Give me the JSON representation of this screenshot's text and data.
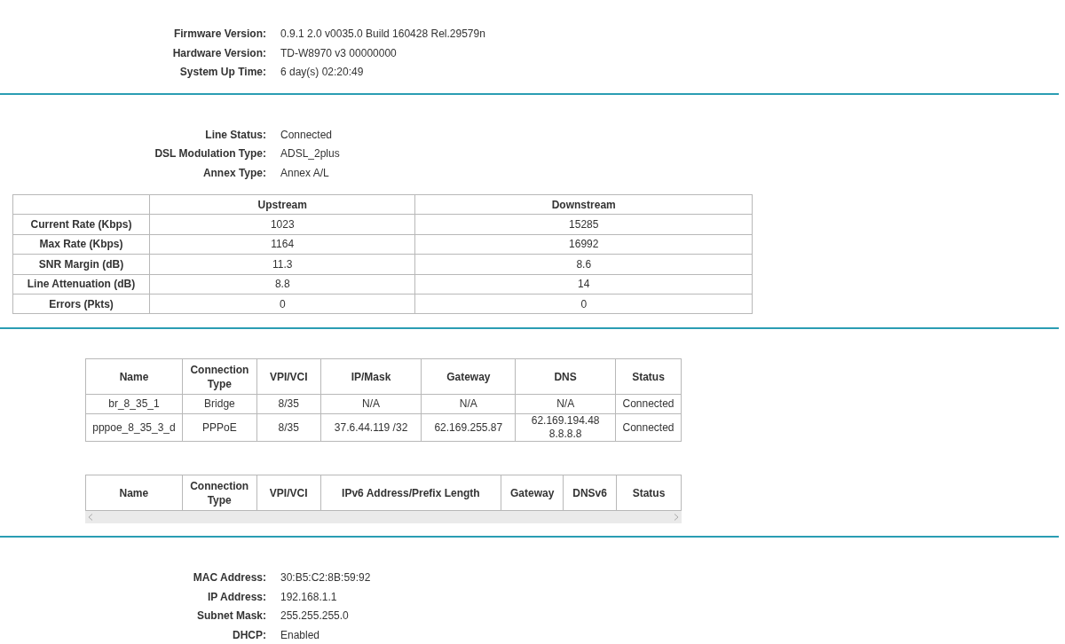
{
  "system": {
    "rows": [
      {
        "label": "Firmware Version:",
        "value": "0.9.1 2.0 v0035.0 Build 160428 Rel.29579n"
      },
      {
        "label": "Hardware Version:",
        "value": "TD-W8970 v3 00000000"
      },
      {
        "label": "System Up Time:",
        "value": "6 day(s) 02:20:49"
      }
    ]
  },
  "dsl": {
    "rows": [
      {
        "label": "Line Status:",
        "value": "Connected"
      },
      {
        "label": "DSL Modulation Type:",
        "value": "ADSL_2plus"
      },
      {
        "label": "Annex Type:",
        "value": "Annex A/L"
      }
    ],
    "table": {
      "columns": [
        "Upstream",
        "Downstream"
      ],
      "rows": [
        {
          "label": "Current Rate (Kbps)",
          "cells": [
            "1023",
            "15285"
          ]
        },
        {
          "label": "Max Rate (Kbps)",
          "cells": [
            "1164",
            "16992"
          ]
        },
        {
          "label": "SNR Margin (dB)",
          "cells": [
            "11.3",
            "8.6"
          ]
        },
        {
          "label": "Line Attenuation (dB)",
          "cells": [
            "8.8",
            "14"
          ]
        },
        {
          "label": "Errors (Pkts)",
          "cells": [
            "0",
            "0"
          ]
        }
      ]
    }
  },
  "wan": {
    "ipv4_table": {
      "columns": [
        "Name",
        "Connection Type",
        "VPI/VCI",
        "IP/Mask",
        "Gateway",
        "DNS",
        "Status"
      ],
      "rows": [
        [
          "br_8_35_1",
          "Bridge",
          "8/35",
          "N/A",
          "N/A",
          "N/A",
          "Connected"
        ],
        [
          "pppoe_8_35_3_d",
          "PPPoE",
          "8/35",
          "37.6.44.119 /32",
          "62.169.255.87",
          "62.169.194.48\n8.8.8.8",
          "Connected"
        ]
      ]
    },
    "ipv6_table": {
      "columns": [
        "Name",
        "Connection Type",
        "VPI/VCI",
        "IPv6 Address/Prefix Length",
        "Gateway",
        "DNSv6",
        "Status"
      ]
    }
  },
  "lan": {
    "rows": [
      {
        "label": "MAC Address:",
        "value": "30:B5:C2:8B:59:92"
      },
      {
        "label": "IP Address:",
        "value": "192.168.1.1"
      },
      {
        "label": "Subnet Mask:",
        "value": "255.255.255.0"
      },
      {
        "label": "DHCP:",
        "value": "Enabled"
      }
    ]
  }
}
